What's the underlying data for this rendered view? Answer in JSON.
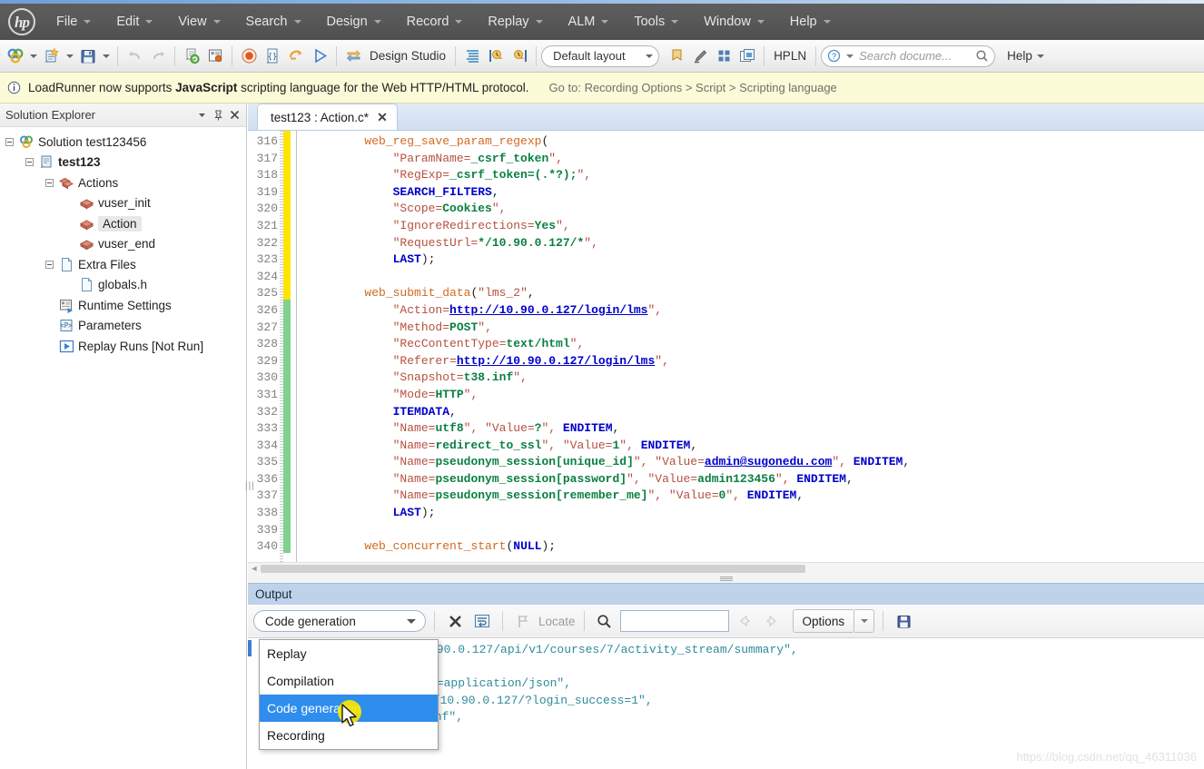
{
  "menubar": {
    "logo": "hp",
    "items": [
      {
        "label": "File",
        "caret": true
      },
      {
        "label": "Edit",
        "caret": true
      },
      {
        "label": "View",
        "caret": true
      },
      {
        "label": "Search",
        "caret": true
      },
      {
        "label": "Design",
        "caret": true
      },
      {
        "label": "Record",
        "caret": true
      },
      {
        "label": "Replay",
        "caret": true
      },
      {
        "label": "ALM",
        "caret": true
      },
      {
        "label": "Tools",
        "caret": true
      },
      {
        "label": "Window",
        "caret": true
      },
      {
        "label": "Help",
        "caret": true
      }
    ]
  },
  "toolbar": {
    "design_studio_label": "Design Studio",
    "layout_label": "Default layout",
    "hpln_label": "HPLN",
    "help_label": "Help",
    "search_placeholder": "Search docume...",
    "icons": [
      "new-solution-icon",
      "new-script-icon",
      "save-icon",
      "undo-icon",
      "redo-icon",
      "regenerate-script-icon",
      "script-properties-icon",
      "record-icon",
      "snapshot-icon",
      "replay-step-icon",
      "run-icon",
      "design-studio-icon",
      "steps-toolbox-icon",
      "start-transaction-icon",
      "end-transaction-icon",
      "bookmark-icon",
      "highlighter-icon",
      "grid-view-icon",
      "window-layout-icon",
      "question-icon",
      "search-icon"
    ]
  },
  "notification": {
    "icon": "info-icon",
    "message_pre": "LoadRunner now supports ",
    "message_bold": "JavaScript",
    "message_post": " scripting language for the Web HTTP/HTML protocol.",
    "goto": "Go to: Recording Options > Script > Scripting language"
  },
  "solution_explorer": {
    "title": "Solution Explorer",
    "header_buttons": [
      "chevron-down-icon",
      "pin-icon",
      "close-icon"
    ],
    "tree": [
      {
        "label": "Solution test123456",
        "indent": 0,
        "icon": "solution-icon",
        "expander": "minus",
        "bold": false,
        "selected": false
      },
      {
        "label": "test123",
        "indent": 1,
        "icon": "script-icon",
        "expander": "minus",
        "bold": true,
        "selected": false
      },
      {
        "label": "Actions",
        "indent": 2,
        "icon": "actions-folder-icon",
        "expander": "minus",
        "bold": false,
        "selected": false
      },
      {
        "label": "vuser_init",
        "indent": 3,
        "icon": "action-icon",
        "expander": "none",
        "bold": false,
        "selected": false
      },
      {
        "label": "Action",
        "indent": 3,
        "icon": "action-icon",
        "expander": "none",
        "bold": false,
        "selected": true
      },
      {
        "label": "vuser_end",
        "indent": 3,
        "icon": "action-icon",
        "expander": "none",
        "bold": false,
        "selected": false
      },
      {
        "label": "Extra Files",
        "indent": 2,
        "icon": "extra-files-icon",
        "expander": "minus",
        "bold": false,
        "selected": false
      },
      {
        "label": "globals.h",
        "indent": 3,
        "icon": "header-file-icon",
        "expander": "none",
        "bold": false,
        "selected": false
      },
      {
        "label": "Runtime Settings",
        "indent": 2,
        "icon": "runtime-settings-icon",
        "expander": "none",
        "bold": false,
        "selected": false
      },
      {
        "label": "Parameters",
        "indent": 2,
        "icon": "parameters-icon",
        "expander": "none",
        "bold": false,
        "selected": false
      },
      {
        "label": "Replay Runs [Not Run]",
        "indent": 2,
        "icon": "replay-runs-icon",
        "expander": "none",
        "bold": false,
        "selected": false
      }
    ]
  },
  "editor": {
    "tab_label": "test123 : Action.c*",
    "tab_close": "✕",
    "first_line_number": 316,
    "lines": [
      {
        "n": 316,
        "mark": "yellow",
        "tokens": [
          {
            "t": "        ",
            "c": "c-pl"
          },
          {
            "t": "web_reg_save_param_regexp",
            "c": "c-fn"
          },
          {
            "t": "(",
            "c": "c-pl"
          }
        ]
      },
      {
        "n": 317,
        "mark": "yellow",
        "tokens": [
          {
            "t": "            ",
            "c": "c-pl"
          },
          {
            "t": "\"ParamName=",
            "c": "c-str"
          },
          {
            "t": "_csrf_token",
            "c": "c-val"
          },
          {
            "t": "\",",
            "c": "c-str"
          }
        ]
      },
      {
        "n": 318,
        "mark": "yellow",
        "tokens": [
          {
            "t": "            ",
            "c": "c-pl"
          },
          {
            "t": "\"RegExp=",
            "c": "c-str"
          },
          {
            "t": "_csrf_token=(.*?);",
            "c": "c-val"
          },
          {
            "t": "\",",
            "c": "c-str"
          }
        ]
      },
      {
        "n": 319,
        "mark": "yellow",
        "tokens": [
          {
            "t": "            ",
            "c": "c-pl"
          },
          {
            "t": "SEARCH_FILTERS",
            "c": "c-kw"
          },
          {
            "t": ",",
            "c": "c-pl"
          }
        ]
      },
      {
        "n": 320,
        "mark": "yellow",
        "tokens": [
          {
            "t": "            ",
            "c": "c-pl"
          },
          {
            "t": "\"Scope=",
            "c": "c-str"
          },
          {
            "t": "Cookies",
            "c": "c-val"
          },
          {
            "t": "\",",
            "c": "c-str"
          }
        ]
      },
      {
        "n": 321,
        "mark": "yellow",
        "tokens": [
          {
            "t": "            ",
            "c": "c-pl"
          },
          {
            "t": "\"IgnoreRedirections=",
            "c": "c-str"
          },
          {
            "t": "Yes",
            "c": "c-val"
          },
          {
            "t": "\",",
            "c": "c-str"
          }
        ]
      },
      {
        "n": 322,
        "mark": "yellow",
        "tokens": [
          {
            "t": "            ",
            "c": "c-pl"
          },
          {
            "t": "\"RequestUrl=",
            "c": "c-str"
          },
          {
            "t": "*/10.90.0.127/*",
            "c": "c-val"
          },
          {
            "t": "\",",
            "c": "c-str"
          }
        ]
      },
      {
        "n": 323,
        "mark": "yellow",
        "tokens": [
          {
            "t": "            ",
            "c": "c-pl"
          },
          {
            "t": "LAST",
            "c": "c-kw"
          },
          {
            "t": ");",
            "c": "c-pl"
          }
        ]
      },
      {
        "n": 324,
        "mark": "yellow",
        "tokens": []
      },
      {
        "n": 325,
        "mark": "yellow",
        "tokens": [
          {
            "t": "        ",
            "c": "c-pl"
          },
          {
            "t": "web_submit_data",
            "c": "c-fn"
          },
          {
            "t": "(",
            "c": "c-pl"
          },
          {
            "t": "\"lms_2\"",
            "c": "c-str"
          },
          {
            "t": ",",
            "c": "c-pl"
          }
        ]
      },
      {
        "n": 326,
        "mark": "green",
        "tokens": [
          {
            "t": "            ",
            "c": "c-pl"
          },
          {
            "t": "\"Action=",
            "c": "c-str"
          },
          {
            "t": "http://10.90.0.127/login/lms",
            "c": "c-url"
          },
          {
            "t": "\",",
            "c": "c-str"
          }
        ]
      },
      {
        "n": 327,
        "mark": "green",
        "tokens": [
          {
            "t": "            ",
            "c": "c-pl"
          },
          {
            "t": "\"Method=",
            "c": "c-str"
          },
          {
            "t": "POST",
            "c": "c-val"
          },
          {
            "t": "\",",
            "c": "c-str"
          }
        ]
      },
      {
        "n": 328,
        "mark": "green",
        "tokens": [
          {
            "t": "            ",
            "c": "c-pl"
          },
          {
            "t": "\"RecContentType=",
            "c": "c-str"
          },
          {
            "t": "text/html",
            "c": "c-val"
          },
          {
            "t": "\",",
            "c": "c-str"
          }
        ]
      },
      {
        "n": 329,
        "mark": "green",
        "tokens": [
          {
            "t": "            ",
            "c": "c-pl"
          },
          {
            "t": "\"Referer=",
            "c": "c-str"
          },
          {
            "t": "http://10.90.0.127/login/lms",
            "c": "c-url"
          },
          {
            "t": "\",",
            "c": "c-str"
          }
        ]
      },
      {
        "n": 330,
        "mark": "green",
        "tokens": [
          {
            "t": "            ",
            "c": "c-pl"
          },
          {
            "t": "\"Snapshot=",
            "c": "c-str"
          },
          {
            "t": "t38.inf",
            "c": "c-val"
          },
          {
            "t": "\",",
            "c": "c-str"
          }
        ]
      },
      {
        "n": 331,
        "mark": "green",
        "tokens": [
          {
            "t": "            ",
            "c": "c-pl"
          },
          {
            "t": "\"Mode=",
            "c": "c-str"
          },
          {
            "t": "HTTP",
            "c": "c-val"
          },
          {
            "t": "\",",
            "c": "c-str"
          }
        ]
      },
      {
        "n": 332,
        "mark": "green",
        "tokens": [
          {
            "t": "            ",
            "c": "c-pl"
          },
          {
            "t": "ITEMDATA",
            "c": "c-kw"
          },
          {
            "t": ",",
            "c": "c-pl"
          }
        ]
      },
      {
        "n": 333,
        "mark": "green",
        "tokens": [
          {
            "t": "            ",
            "c": "c-pl"
          },
          {
            "t": "\"Name=",
            "c": "c-str"
          },
          {
            "t": "utf8",
            "c": "c-val"
          },
          {
            "t": "\", ",
            "c": "c-str"
          },
          {
            "t": "\"Value=",
            "c": "c-str"
          },
          {
            "t": "?",
            "c": "c-val"
          },
          {
            "t": "\", ",
            "c": "c-str"
          },
          {
            "t": "ENDITEM",
            "c": "c-kw"
          },
          {
            "t": ",",
            "c": "c-pl"
          }
        ]
      },
      {
        "n": 334,
        "mark": "green",
        "tokens": [
          {
            "t": "            ",
            "c": "c-pl"
          },
          {
            "t": "\"Name=",
            "c": "c-str"
          },
          {
            "t": "redirect_to_ssl",
            "c": "c-val"
          },
          {
            "t": "\", ",
            "c": "c-str"
          },
          {
            "t": "\"Value=",
            "c": "c-str"
          },
          {
            "t": "1",
            "c": "c-val"
          },
          {
            "t": "\", ",
            "c": "c-str"
          },
          {
            "t": "ENDITEM",
            "c": "c-kw"
          },
          {
            "t": ",",
            "c": "c-pl"
          }
        ]
      },
      {
        "n": 335,
        "mark": "green",
        "tokens": [
          {
            "t": "            ",
            "c": "c-pl"
          },
          {
            "t": "\"Name=",
            "c": "c-str"
          },
          {
            "t": "pseudonym_session[unique_id]",
            "c": "c-val"
          },
          {
            "t": "\", ",
            "c": "c-str"
          },
          {
            "t": "\"Value=",
            "c": "c-str"
          },
          {
            "t": "admin@sugonedu.com",
            "c": "c-url"
          },
          {
            "t": "\", ",
            "c": "c-str"
          },
          {
            "t": "ENDITEM",
            "c": "c-kw"
          },
          {
            "t": ",",
            "c": "c-pl"
          }
        ]
      },
      {
        "n": 336,
        "mark": "green",
        "tokens": [
          {
            "t": "            ",
            "c": "c-pl"
          },
          {
            "t": "\"Name=",
            "c": "c-str"
          },
          {
            "t": "pseudonym_session[password]",
            "c": "c-val"
          },
          {
            "t": "\", ",
            "c": "c-str"
          },
          {
            "t": "\"Value=",
            "c": "c-str"
          },
          {
            "t": "admin123456",
            "c": "c-val"
          },
          {
            "t": "\", ",
            "c": "c-str"
          },
          {
            "t": "ENDITEM",
            "c": "c-kw"
          },
          {
            "t": ",",
            "c": "c-pl"
          }
        ]
      },
      {
        "n": 337,
        "mark": "green",
        "tokens": [
          {
            "t": "            ",
            "c": "c-pl"
          },
          {
            "t": "\"Name=",
            "c": "c-str"
          },
          {
            "t": "pseudonym_session[remember_me]",
            "c": "c-val"
          },
          {
            "t": "\", ",
            "c": "c-str"
          },
          {
            "t": "\"Value=",
            "c": "c-str"
          },
          {
            "t": "0",
            "c": "c-val"
          },
          {
            "t": "\", ",
            "c": "c-str"
          },
          {
            "t": "ENDITEM",
            "c": "c-kw"
          },
          {
            "t": ",",
            "c": "c-pl"
          }
        ]
      },
      {
        "n": 338,
        "mark": "green",
        "tokens": [
          {
            "t": "            ",
            "c": "c-pl"
          },
          {
            "t": "LAST",
            "c": "c-kw"
          },
          {
            "t": ");",
            "c": "c-pl"
          }
        ]
      },
      {
        "n": 339,
        "mark": "green",
        "tokens": []
      },
      {
        "n": 340,
        "mark": "green",
        "tokens": [
          {
            "t": "        ",
            "c": "c-pl"
          },
          {
            "t": "web_concurrent_start",
            "c": "c-fn"
          },
          {
            "t": "(",
            "c": "c-pl"
          },
          {
            "t": "NULL",
            "c": "c-kw"
          },
          {
            "t": ");",
            "c": "c-pl"
          }
        ]
      }
    ]
  },
  "output": {
    "title": "Output",
    "filter_value": "Code generation",
    "buttons": {
      "clear": "clear-output-icon",
      "wordwrap": "word-wrap-icon",
      "locate_label": "Locate",
      "find": "search-icon",
      "prev": "prev-icon",
      "next": "next-icon",
      "options_label": "Options",
      "save": "save-icon"
    },
    "search_value": "",
    "lines": [
      ".90.0.127/api/v1/courses/7/activity_stream/summary\",",
      "",
      "e=application/json\",",
      "//10.90.0.127/?login_success=1\",",
      "inf\","
    ],
    "dropdown": {
      "items": [
        "Replay",
        "Compilation",
        "Code generation",
        "Recording"
      ],
      "active": "Code generation"
    }
  },
  "watermark": "https://blog.csdn.net/qq_46311036",
  "colors": {
    "menu_bg": "#585858",
    "notify_bg": "#fbfbd8",
    "output_title_bg": "#bed3ea",
    "dropdown_active": "#2e8ded",
    "changebar_yellow": "#ffe400",
    "changebar_green": "#7fd18d",
    "output_text": "#2e8b9b"
  }
}
